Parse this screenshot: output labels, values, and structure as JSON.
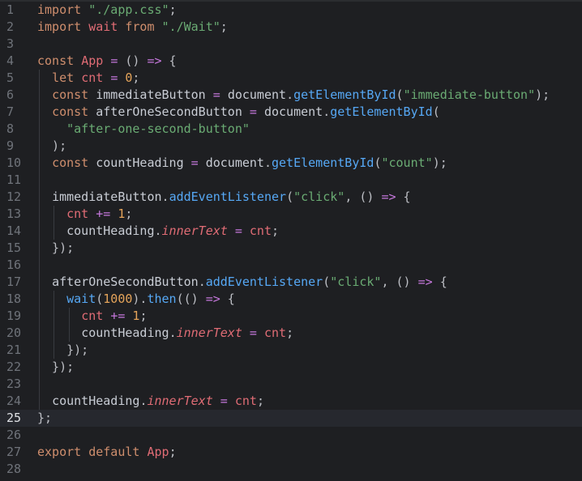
{
  "editor": {
    "lines": [
      {
        "n": "1",
        "tokens": [
          [
            "kw",
            "import"
          ],
          [
            "punc",
            " "
          ],
          [
            "str",
            "\"./app.css\""
          ],
          [
            "punc",
            ";"
          ]
        ]
      },
      {
        "n": "2",
        "tokens": [
          [
            "kw",
            "import"
          ],
          [
            "punc",
            " "
          ],
          [
            "var",
            "wait"
          ],
          [
            "punc",
            " "
          ],
          [
            "kw",
            "from"
          ],
          [
            "punc",
            " "
          ],
          [
            "str",
            "\"./Wait\""
          ],
          [
            "punc",
            ";"
          ]
        ]
      },
      {
        "n": "3",
        "tokens": []
      },
      {
        "n": "4",
        "tokens": [
          [
            "kw",
            "const"
          ],
          [
            "punc",
            " "
          ],
          [
            "cls",
            "App"
          ],
          [
            "punc",
            " "
          ],
          [
            "op",
            "="
          ],
          [
            "punc",
            " () "
          ],
          [
            "op",
            "=>"
          ],
          [
            "punc",
            " {"
          ]
        ]
      },
      {
        "n": "5",
        "tokens": [
          [
            "punc",
            "  "
          ],
          [
            "kw",
            "let"
          ],
          [
            "punc",
            " "
          ],
          [
            "var",
            "cnt"
          ],
          [
            "punc",
            " "
          ],
          [
            "op",
            "="
          ],
          [
            "punc",
            " "
          ],
          [
            "num",
            "0"
          ],
          [
            "punc",
            ";"
          ]
        ]
      },
      {
        "n": "6",
        "tokens": [
          [
            "punc",
            "  "
          ],
          [
            "kw",
            "const"
          ],
          [
            "punc",
            " "
          ],
          [
            "ident",
            "immediateButton"
          ],
          [
            "punc",
            " "
          ],
          [
            "op",
            "="
          ],
          [
            "punc",
            " "
          ],
          [
            "ident",
            "document"
          ],
          [
            "punc",
            "."
          ],
          [
            "method",
            "getElementById"
          ],
          [
            "punc",
            "("
          ],
          [
            "str",
            "\"immediate-button\""
          ],
          [
            "punc",
            ");"
          ]
        ]
      },
      {
        "n": "7",
        "tokens": [
          [
            "punc",
            "  "
          ],
          [
            "kw",
            "const"
          ],
          [
            "punc",
            " "
          ],
          [
            "ident",
            "afterOneSecondButton"
          ],
          [
            "punc",
            " "
          ],
          [
            "op",
            "="
          ],
          [
            "punc",
            " "
          ],
          [
            "ident",
            "document"
          ],
          [
            "punc",
            "."
          ],
          [
            "method",
            "getElementById"
          ],
          [
            "punc",
            "("
          ]
        ]
      },
      {
        "n": "8",
        "tokens": [
          [
            "punc",
            "    "
          ],
          [
            "str",
            "\"after-one-second-button\""
          ]
        ]
      },
      {
        "n": "9",
        "tokens": [
          [
            "punc",
            "  );"
          ]
        ]
      },
      {
        "n": "10",
        "tokens": [
          [
            "punc",
            "  "
          ],
          [
            "kw",
            "const"
          ],
          [
            "punc",
            " "
          ],
          [
            "ident",
            "countHeading"
          ],
          [
            "punc",
            " "
          ],
          [
            "op",
            "="
          ],
          [
            "punc",
            " "
          ],
          [
            "ident",
            "document"
          ],
          [
            "punc",
            "."
          ],
          [
            "method",
            "getElementById"
          ],
          [
            "punc",
            "("
          ],
          [
            "str",
            "\"count\""
          ],
          [
            "punc",
            ");"
          ]
        ]
      },
      {
        "n": "11",
        "tokens": []
      },
      {
        "n": "12",
        "tokens": [
          [
            "punc",
            "  "
          ],
          [
            "ident",
            "immediateButton"
          ],
          [
            "punc",
            "."
          ],
          [
            "method",
            "addEventListener"
          ],
          [
            "punc",
            "("
          ],
          [
            "str",
            "\"click\""
          ],
          [
            "punc",
            ", () "
          ],
          [
            "op",
            "=>"
          ],
          [
            "punc",
            " {"
          ]
        ]
      },
      {
        "n": "13",
        "tokens": [
          [
            "punc",
            "    "
          ],
          [
            "var",
            "cnt"
          ],
          [
            "punc",
            " "
          ],
          [
            "op",
            "+="
          ],
          [
            "punc",
            " "
          ],
          [
            "num",
            "1"
          ],
          [
            "punc",
            ";"
          ]
        ]
      },
      {
        "n": "14",
        "tokens": [
          [
            "punc",
            "    "
          ],
          [
            "ident",
            "countHeading"
          ],
          [
            "punc",
            "."
          ],
          [
            "prop",
            "innerText"
          ],
          [
            "punc",
            " "
          ],
          [
            "op",
            "="
          ],
          [
            "punc",
            " "
          ],
          [
            "var",
            "cnt"
          ],
          [
            "punc",
            ";"
          ]
        ]
      },
      {
        "n": "15",
        "tokens": [
          [
            "punc",
            "  });"
          ]
        ]
      },
      {
        "n": "16",
        "tokens": []
      },
      {
        "n": "17",
        "tokens": [
          [
            "punc",
            "  "
          ],
          [
            "ident",
            "afterOneSecondButton"
          ],
          [
            "punc",
            "."
          ],
          [
            "method",
            "addEventListener"
          ],
          [
            "punc",
            "("
          ],
          [
            "str",
            "\"click\""
          ],
          [
            "punc",
            ", () "
          ],
          [
            "op",
            "=>"
          ],
          [
            "punc",
            " {"
          ]
        ]
      },
      {
        "n": "18",
        "tokens": [
          [
            "punc",
            "    "
          ],
          [
            "fn",
            "wait"
          ],
          [
            "punc",
            "("
          ],
          [
            "num",
            "1000"
          ],
          [
            "punc",
            ")."
          ],
          [
            "method",
            "then"
          ],
          [
            "punc",
            "(() "
          ],
          [
            "op",
            "=>"
          ],
          [
            "punc",
            " {"
          ]
        ]
      },
      {
        "n": "19",
        "tokens": [
          [
            "punc",
            "      "
          ],
          [
            "var",
            "cnt"
          ],
          [
            "punc",
            " "
          ],
          [
            "op",
            "+="
          ],
          [
            "punc",
            " "
          ],
          [
            "num",
            "1"
          ],
          [
            "punc",
            ";"
          ]
        ]
      },
      {
        "n": "20",
        "tokens": [
          [
            "punc",
            "      "
          ],
          [
            "ident",
            "countHeading"
          ],
          [
            "punc",
            "."
          ],
          [
            "prop",
            "innerText"
          ],
          [
            "punc",
            " "
          ],
          [
            "op",
            "="
          ],
          [
            "punc",
            " "
          ],
          [
            "var",
            "cnt"
          ],
          [
            "punc",
            ";"
          ]
        ]
      },
      {
        "n": "21",
        "tokens": [
          [
            "punc",
            "    });"
          ]
        ]
      },
      {
        "n": "22",
        "tokens": [
          [
            "punc",
            "  });"
          ]
        ]
      },
      {
        "n": "23",
        "tokens": []
      },
      {
        "n": "24",
        "tokens": [
          [
            "punc",
            "  "
          ],
          [
            "ident",
            "countHeading"
          ],
          [
            "punc",
            "."
          ],
          [
            "prop",
            "innerText"
          ],
          [
            "punc",
            " "
          ],
          [
            "op",
            "="
          ],
          [
            "punc",
            " "
          ],
          [
            "var",
            "cnt"
          ],
          [
            "punc",
            ";"
          ]
        ]
      },
      {
        "n": "25",
        "tokens": [
          [
            "punc",
            "};"
          ]
        ],
        "current": true
      },
      {
        "n": "26",
        "tokens": []
      },
      {
        "n": "27",
        "tokens": [
          [
            "kw",
            "export"
          ],
          [
            "punc",
            " "
          ],
          [
            "kw",
            "default"
          ],
          [
            "punc",
            " "
          ],
          [
            "cls",
            "App"
          ],
          [
            "punc",
            ";"
          ]
        ]
      },
      {
        "n": "28",
        "tokens": []
      }
    ]
  },
  "colors": {
    "background": "#1e1f22",
    "current_line": "#26282e",
    "keyword": "#cf8e6d",
    "string": "#6aab73",
    "function": "#56a8f5",
    "number": "#e5a45a"
  }
}
